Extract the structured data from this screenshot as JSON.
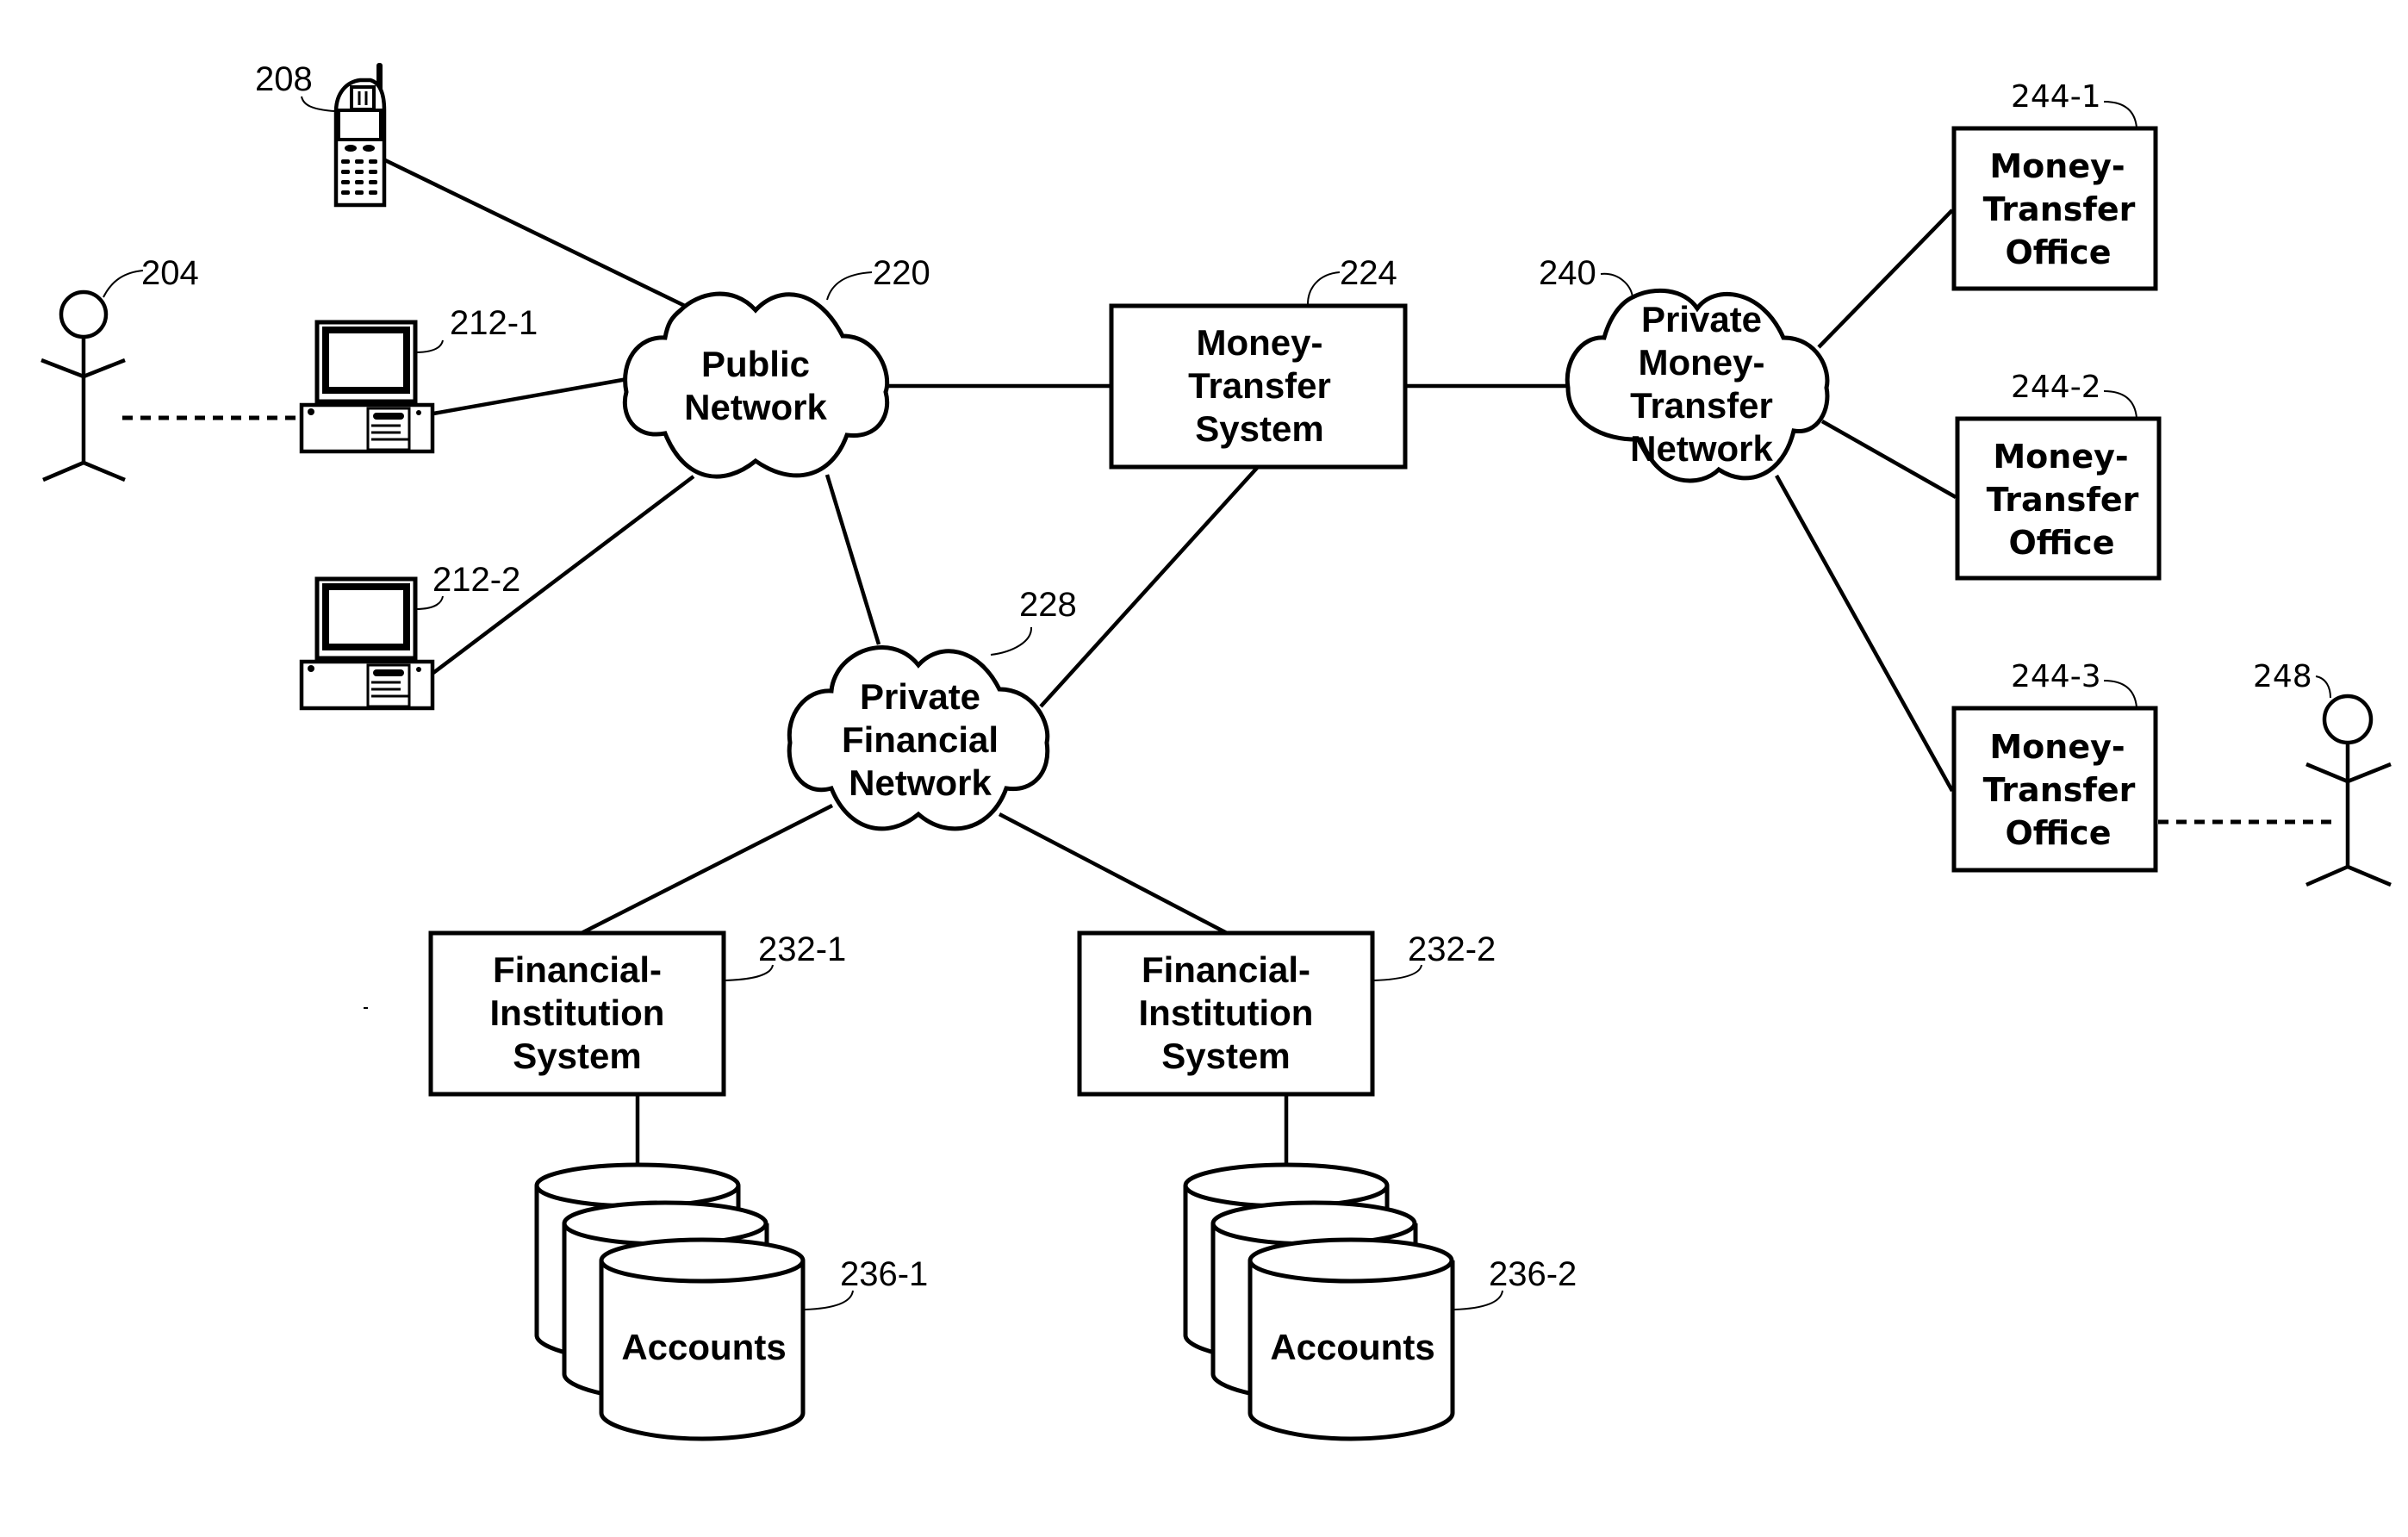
{
  "figure": {
    "type": "network-diagram",
    "background_color": "#ffffff",
    "line_color": "#000000"
  },
  "actors": [
    {
      "id": "204",
      "ref_label": "204",
      "icon": "person-icon"
    },
    {
      "id": "248",
      "ref_label": "248",
      "icon": "person-icon"
    }
  ],
  "devices": [
    {
      "id": "208",
      "ref_label": "208",
      "icon": "mobile-phone-icon"
    },
    {
      "id": "212-1",
      "ref_label": "212-1",
      "icon": "desktop-computer-icon"
    },
    {
      "id": "212-2",
      "ref_label": "212-2",
      "icon": "desktop-computer-icon"
    }
  ],
  "networks": [
    {
      "id": "220",
      "ref_label": "220",
      "lines": [
        "Public",
        "Network"
      ],
      "icon": "cloud-icon"
    },
    {
      "id": "228",
      "ref_label": "228",
      "lines": [
        "Private",
        "Financial",
        "Network"
      ],
      "icon": "cloud-icon"
    },
    {
      "id": "240",
      "ref_label": "240",
      "lines": [
        "Private",
        "Money-",
        "Transfer",
        "Network"
      ],
      "icon": "cloud-icon"
    }
  ],
  "systems": [
    {
      "id": "224",
      "ref_label": "224",
      "lines": [
        "Money-",
        "Transfer",
        "System"
      ]
    },
    {
      "id": "232-1",
      "ref_label": "232-1",
      "lines": [
        "Financial-",
        "Institution",
        "System"
      ]
    },
    {
      "id": "232-2",
      "ref_label": "232-2",
      "lines": [
        "Financial-",
        "Institution",
        "System"
      ]
    }
  ],
  "offices": [
    {
      "id": "244-1",
      "ref_label": "244-1",
      "lines": [
        "Money-",
        "Transfer",
        "Office"
      ]
    },
    {
      "id": "244-2",
      "ref_label": "244-2",
      "lines": [
        "Money-",
        "Transfer",
        "Office"
      ]
    },
    {
      "id": "244-3",
      "ref_label": "244-3",
      "lines": [
        "Money-",
        "Transfer",
        "Office"
      ]
    }
  ],
  "databases": [
    {
      "id": "236-1",
      "ref_label": "236-1",
      "label": "Accounts",
      "icon": "database-stack-icon"
    },
    {
      "id": "236-2",
      "ref_label": "236-2",
      "label": "Accounts",
      "icon": "database-stack-icon"
    }
  ],
  "connections": [
    {
      "from": "208",
      "to": "220",
      "style": "solid"
    },
    {
      "from": "212-1",
      "to": "220",
      "style": "solid"
    },
    {
      "from": "212-2",
      "to": "220",
      "style": "solid"
    },
    {
      "from": "204",
      "to": "212-1",
      "style": "dashed"
    },
    {
      "from": "220",
      "to": "224",
      "style": "solid"
    },
    {
      "from": "220",
      "to": "228",
      "style": "solid"
    },
    {
      "from": "224",
      "to": "228",
      "style": "solid"
    },
    {
      "from": "224",
      "to": "240",
      "style": "solid"
    },
    {
      "from": "240",
      "to": "244-1",
      "style": "solid"
    },
    {
      "from": "240",
      "to": "244-2",
      "style": "solid"
    },
    {
      "from": "240",
      "to": "244-3",
      "style": "solid"
    },
    {
      "from": "244-3",
      "to": "248",
      "style": "dashed"
    },
    {
      "from": "228",
      "to": "232-1",
      "style": "solid"
    },
    {
      "from": "228",
      "to": "232-2",
      "style": "solid"
    },
    {
      "from": "232-1",
      "to": "236-1",
      "style": "solid"
    },
    {
      "from": "232-2",
      "to": "236-2",
      "style": "solid"
    }
  ]
}
